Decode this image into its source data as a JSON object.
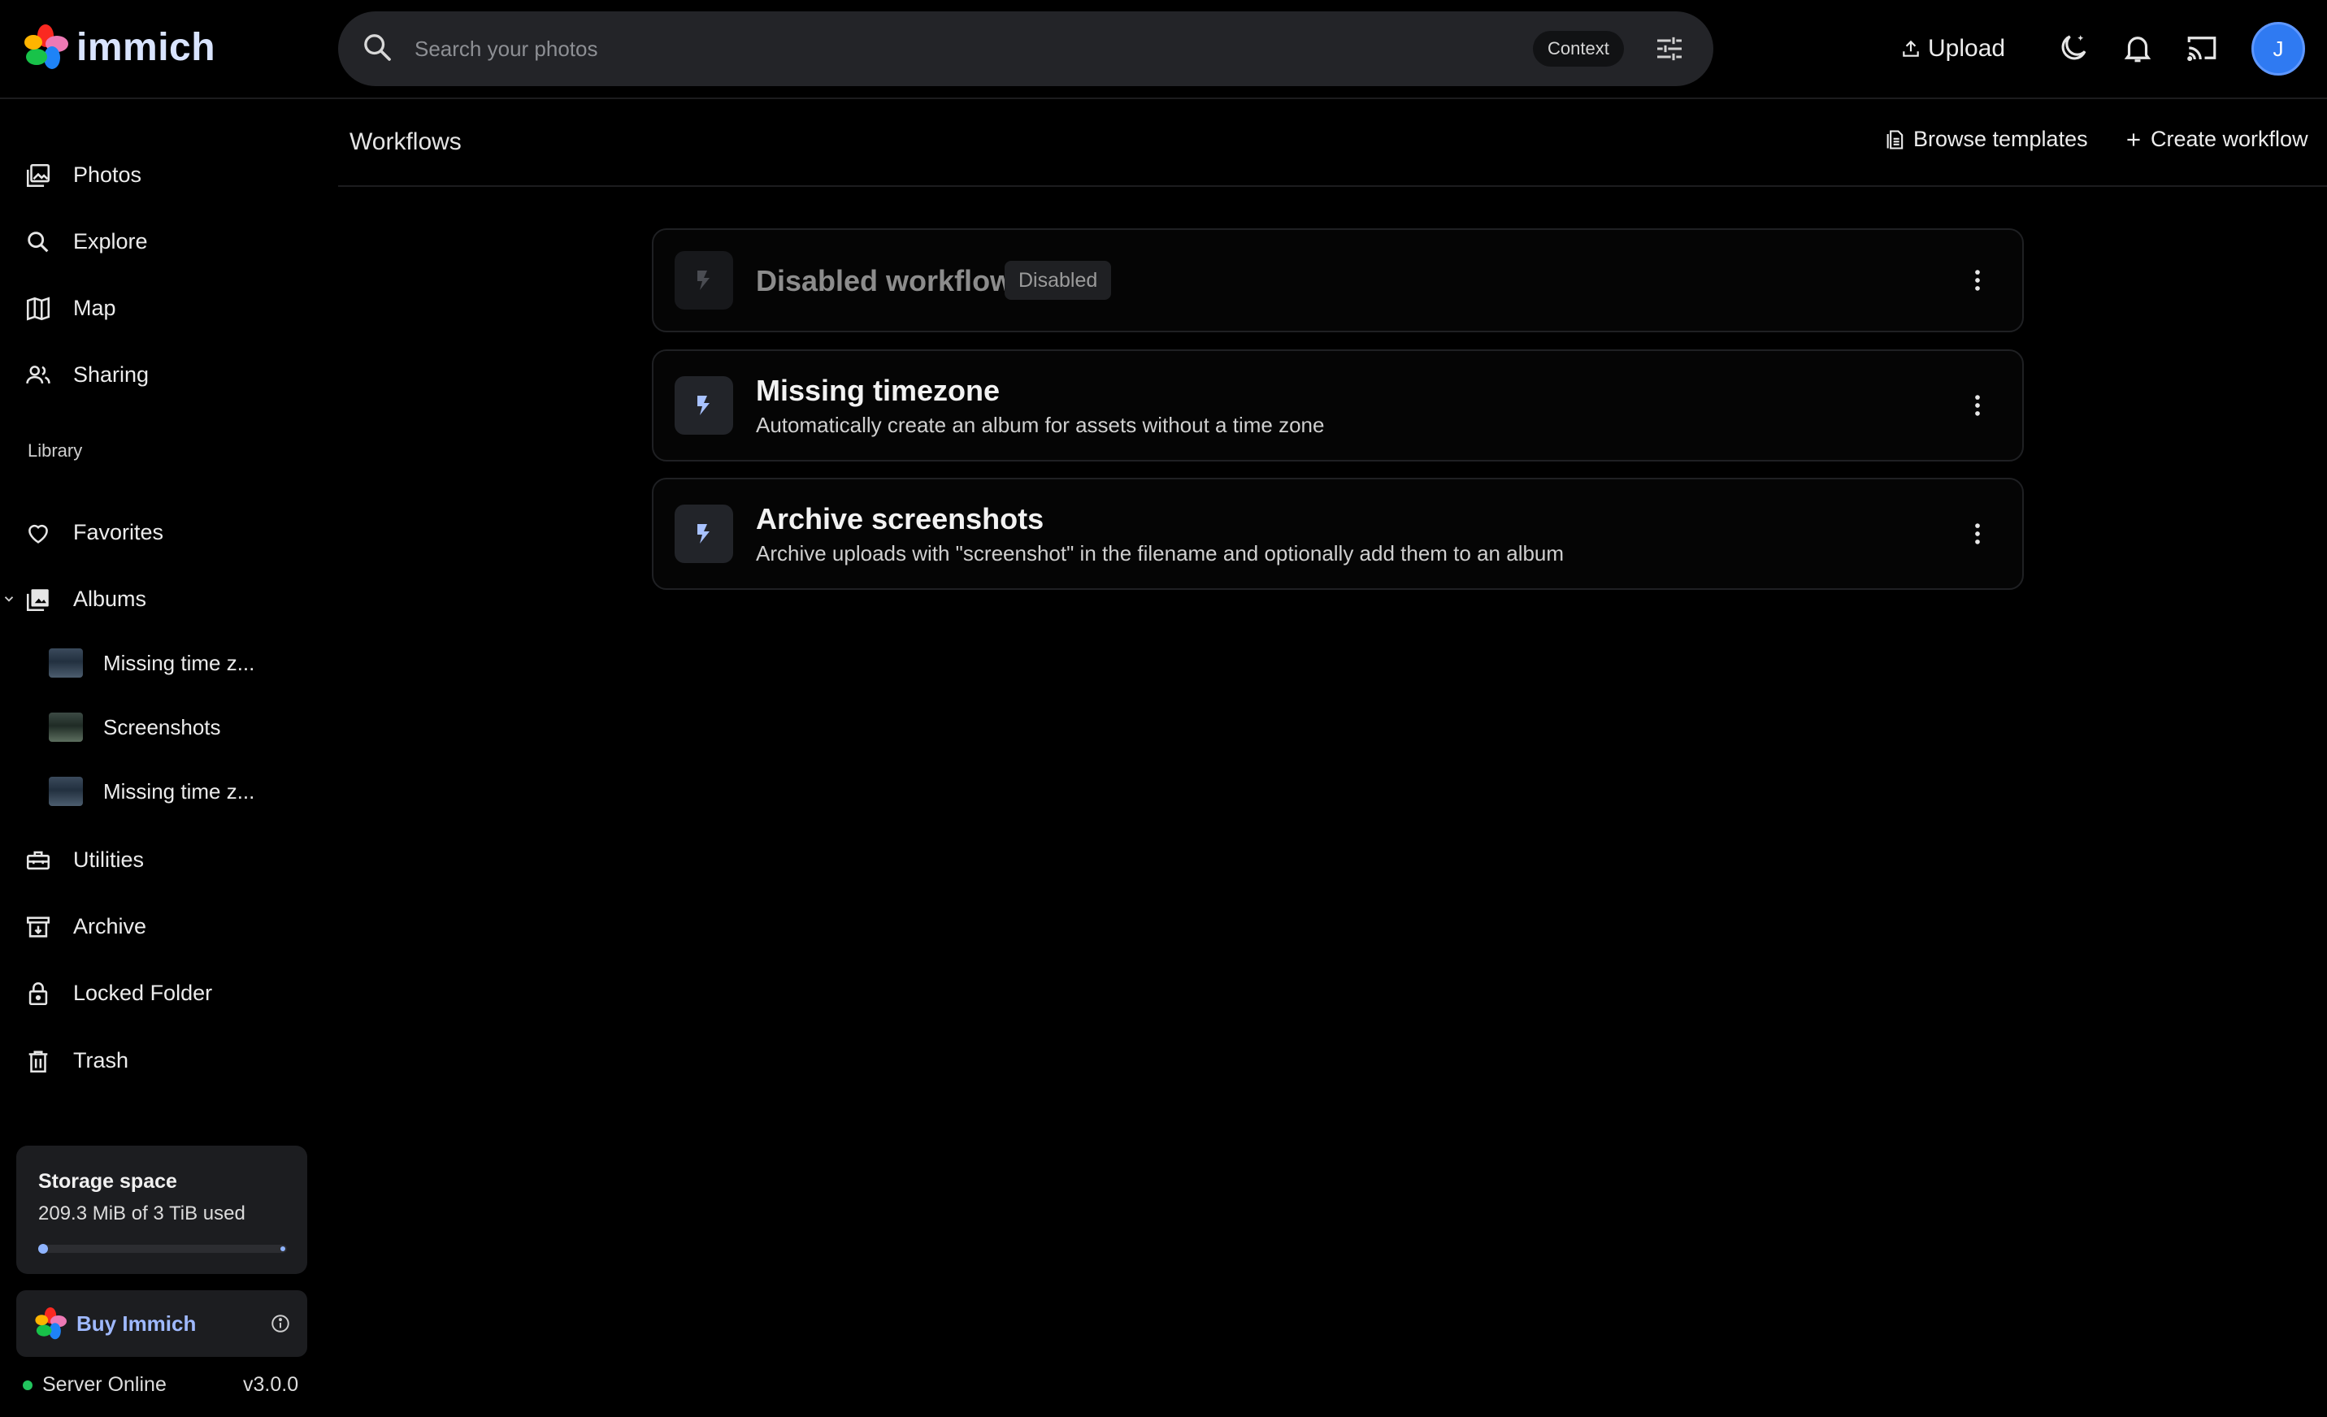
{
  "app": {
    "name": "immich",
    "colors": {
      "background": "#000000",
      "accent": "#9fb9ff",
      "avatar": "#2f7af2",
      "online": "#22c55e"
    }
  },
  "topbar": {
    "search_placeholder": "Search your photos",
    "context_label": "Context",
    "upload_label": "Upload",
    "avatar_initial": "J",
    "icons": [
      "search-icon",
      "tune-icon",
      "upload-icon",
      "theme-icon",
      "bell-icon",
      "cast-icon"
    ]
  },
  "sidebar": {
    "items": [
      {
        "label": "Photos",
        "icon": "photos-icon"
      },
      {
        "label": "Explore",
        "icon": "search-icon"
      },
      {
        "label": "Map",
        "icon": "map-icon"
      },
      {
        "label": "Sharing",
        "icon": "sharing-icon"
      }
    ],
    "library_label": "Library",
    "library_items": [
      {
        "label": "Favorites",
        "icon": "heart-icon"
      },
      {
        "label": "Albums",
        "icon": "albums-icon",
        "expanded": true
      }
    ],
    "albums": [
      {
        "label": "Missing time z..."
      },
      {
        "label": "Screenshots"
      },
      {
        "label": "Missing time z..."
      }
    ],
    "more_items": [
      {
        "label": "Utilities",
        "icon": "toolbox-icon"
      },
      {
        "label": "Archive",
        "icon": "archive-icon"
      },
      {
        "label": "Locked Folder",
        "icon": "lock-icon"
      },
      {
        "label": "Trash",
        "icon": "trash-icon"
      }
    ],
    "storage": {
      "title": "Storage space",
      "used_text": "209.3 MiB of 3 TiB used",
      "used_fraction": 7e-05
    },
    "buy_label": "Buy Immich",
    "server_status": "Server Online",
    "version": "v3.0.0"
  },
  "main": {
    "title": "Workflows",
    "browse_templates_label": "Browse templates",
    "create_workflow_label": "Create workflow",
    "workflows": [
      {
        "title": "Disabled workflow",
        "badge": "Disabled",
        "description": "",
        "enabled": false
      },
      {
        "title": "Missing timezone",
        "description": "Automatically create an album for assets without a time zone",
        "enabled": true
      },
      {
        "title": "Archive screenshots",
        "description": "Archive uploads with \"screenshot\" in the filename and optionally add them to an album",
        "enabled": true
      }
    ]
  }
}
